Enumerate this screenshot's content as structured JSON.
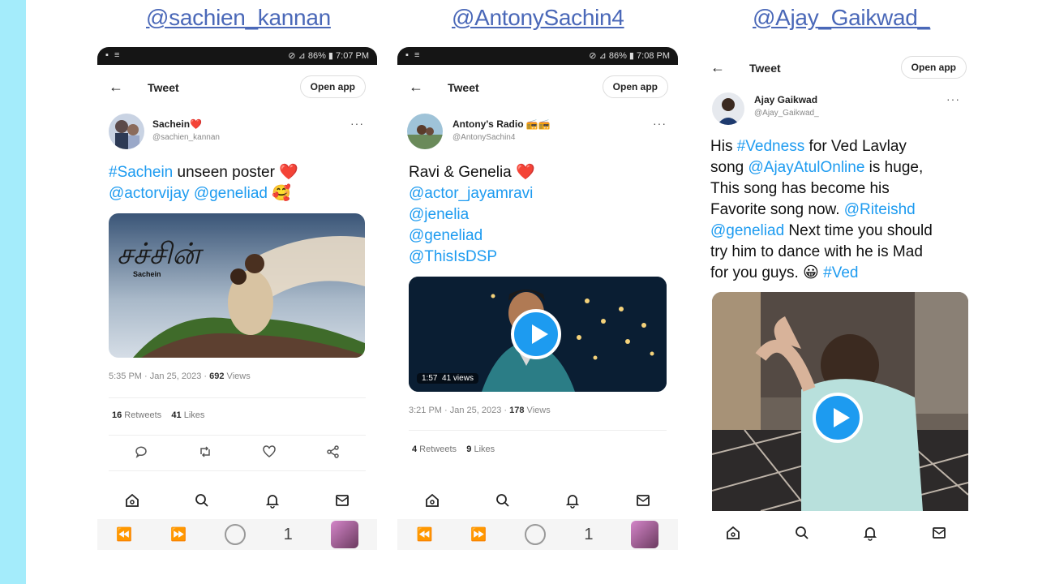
{
  "panels": [
    {
      "handle": "@sachien_kannan",
      "status": {
        "left": "▪ ≡",
        "right": "⊘ ⊿ 86% ▮ 7:07 PM"
      },
      "topbar": {
        "back": "←",
        "title": "Tweet",
        "open_app": "Open app"
      },
      "author": {
        "name": "Sachein❤️",
        "username": "@sachien_kannan"
      },
      "more": "···",
      "tweet_lines": [
        [
          {
            "t": "#Sachein",
            "link": true
          },
          {
            "t": " unseen poster ❤️",
            "link": false
          }
        ],
        [
          {
            "t": "@actorvijay @geneliad",
            "link": true
          },
          {
            "t": " 🥰",
            "link": false
          }
        ]
      ],
      "media": {
        "kind": "image",
        "caption": "Sachein"
      },
      "timestamp": "5:35 PM · Jan 25, 2023 · ",
      "views_count": "692",
      "views_label": " Views",
      "retweets_count": "16",
      "retweets_label": " Retweets",
      "likes_count": "41",
      "likes_label": " Likes"
    },
    {
      "handle": "@AntonySachin4",
      "status": {
        "left": "▪ ≡",
        "right": "⊘ ⊿ 86% ▮ 7:08 PM"
      },
      "topbar": {
        "back": "←",
        "title": "Tweet",
        "open_app": "Open app"
      },
      "author": {
        "name": "Antony's Radio 📻📻",
        "username": "@AntonySachin4"
      },
      "more": "···",
      "tweet_lines": [
        [
          {
            "t": "Ravi & Genelia ❤️",
            "link": false
          }
        ],
        [
          {
            "t": "@actor_jayamravi",
            "link": true
          }
        ],
        [
          {
            "t": "@jenelia",
            "link": true
          }
        ],
        [
          {
            "t": "@geneliad",
            "link": true
          }
        ],
        [
          {
            "t": "@ThisIsDSP",
            "link": true
          }
        ]
      ],
      "media": {
        "kind": "video",
        "duration": "1:57",
        "views": "41 views"
      },
      "timestamp": "3:21 PM · Jan 25, 2023 · ",
      "views_count": "178",
      "views_label": " Views",
      "retweets_count": "4",
      "retweets_label": " Retweets",
      "likes_count": "9",
      "likes_label": " Likes"
    },
    {
      "handle": "@Ajay_Gaikwad_",
      "topbar": {
        "back": "←",
        "title": "Tweet",
        "open_app": "Open app"
      },
      "author": {
        "name": "Ajay Gaikwad",
        "username": "@Ajay_Gaikwad_"
      },
      "more": "···",
      "tweet_lines": [
        [
          {
            "t": "His ",
            "link": false
          },
          {
            "t": "#Vedness",
            "link": true
          },
          {
            "t": " for Ved Lavlay",
            "link": false
          }
        ],
        [
          {
            "t": "song ",
            "link": false
          },
          {
            "t": "@AjayAtulOnline",
            "link": true
          },
          {
            "t": " is huge,",
            "link": false
          }
        ],
        [
          {
            "t": "This song has become his",
            "link": false
          }
        ],
        [
          {
            "t": "Favorite song now. ",
            "link": false
          },
          {
            "t": "@Riteishd",
            "link": true
          }
        ],
        [
          {
            "t": "@geneliad",
            "link": true
          },
          {
            "t": " Next time you should",
            "link": false
          }
        ],
        [
          {
            "t": "try him to dance with he is Mad",
            "link": false
          }
        ],
        [
          {
            "t": "for you guys. 😀 ",
            "link": false
          },
          {
            "t": "#Ved",
            "link": true
          }
        ]
      ],
      "media": {
        "kind": "video"
      }
    }
  ],
  "bottom_nav": {
    "page_number": "1"
  },
  "colors": {
    "side_bar": "#a4ecfb",
    "handle": "#4a68b8",
    "link": "#1d9bf0"
  }
}
